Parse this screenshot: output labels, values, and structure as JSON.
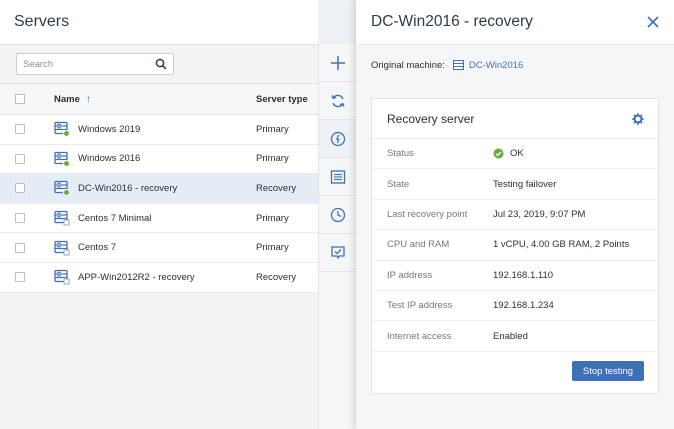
{
  "left": {
    "title": "Servers",
    "search_placeholder": "Search",
    "columns": {
      "name": "Name",
      "type": "Server type"
    },
    "rows": [
      {
        "name": "Windows 2019",
        "type": "Primary",
        "status": "ok"
      },
      {
        "name": "Windows 2016",
        "type": "Primary",
        "status": "ok"
      },
      {
        "name": "DC-Win2016 - recovery",
        "type": "Recovery",
        "status": "ok"
      },
      {
        "name": "Centos 7 Minimal",
        "type": "Primary",
        "status": "none"
      },
      {
        "name": "Centos 7",
        "type": "Primary",
        "status": "none"
      },
      {
        "name": "APP-Win2012R2 - recovery",
        "type": "Recovery",
        "status": "none"
      }
    ]
  },
  "toolbar": {
    "icons": [
      "plus-icon",
      "refresh-icon",
      "power-icon",
      "log-icon",
      "clock-icon",
      "checklist-icon"
    ]
  },
  "right": {
    "title": "DC-Win2016 - recovery",
    "original_machine_label": "Original machine:",
    "original_machine_value": "DC-Win2016",
    "card": {
      "title": "Recovery server",
      "fields": [
        {
          "key": "Status",
          "value": "OK"
        },
        {
          "key": "State",
          "value": "Testing failover"
        },
        {
          "key": "Last recovery point",
          "value": "Jul 23, 2019, 9:07 PM"
        },
        {
          "key": "CPU and RAM",
          "value": "1 vCPU, 4.00 GB RAM, 2 Points"
        },
        {
          "key": "IP address",
          "value": "192.168.1.110"
        },
        {
          "key": "Test IP address",
          "value": "192.168.1.234"
        },
        {
          "key": "Internet access",
          "value": "Enabled"
        }
      ],
      "button": "Stop testing"
    }
  },
  "colors": {
    "accent": "#3f70b5",
    "link": "#3a73b8",
    "ok": "#6aab3a",
    "selected_row": "#e6ecf5"
  }
}
